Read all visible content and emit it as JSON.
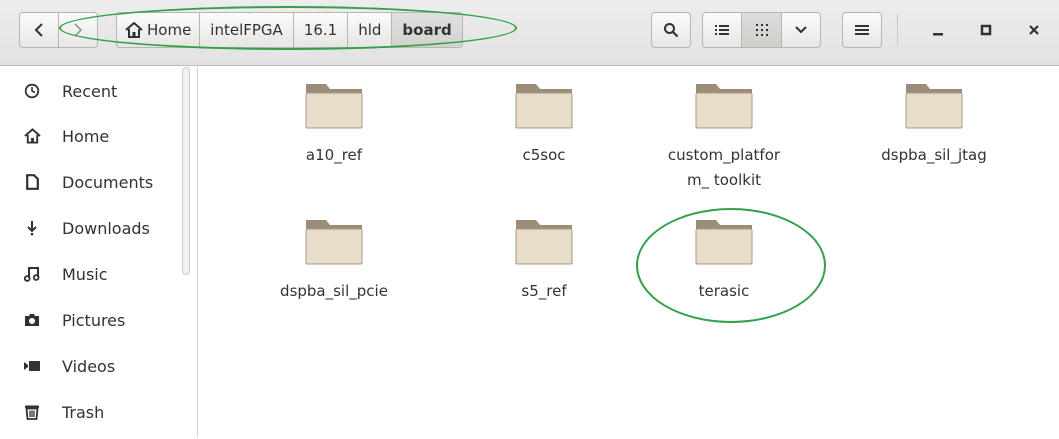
{
  "headerbar": {
    "breadcrumbs": [
      "Home",
      "intelFPGA",
      "16.1",
      "hld",
      "board"
    ],
    "active_crumb": "board",
    "icons": {
      "back": "chevron-left-icon",
      "forward": "chevron-right-icon",
      "home": "home-icon",
      "search": "search-icon",
      "list_view": "list-view-icon",
      "grid_view": "grid-view-icon",
      "view_options": "chevron-down-icon",
      "menu": "hamburger-menu-icon",
      "minimize": "minimize-icon",
      "maximize": "maximize-icon",
      "close": "close-icon"
    }
  },
  "sidebar": {
    "items": [
      {
        "label": "Recent",
        "icon": "clock-icon"
      },
      {
        "label": "Home",
        "icon": "home-icon"
      },
      {
        "label": "Documents",
        "icon": "document-icon"
      },
      {
        "label": "Downloads",
        "icon": "download-icon"
      },
      {
        "label": "Music",
        "icon": "music-icon"
      },
      {
        "label": "Pictures",
        "icon": "camera-icon"
      },
      {
        "label": "Videos",
        "icon": "video-icon"
      },
      {
        "label": "Trash",
        "icon": "trash-icon"
      }
    ]
  },
  "files": [
    {
      "name": "a10_ref",
      "icon": "folder-icon"
    },
    {
      "name": "c5soc",
      "icon": "folder-icon"
    },
    {
      "name": "custom_platform_ toolkit",
      "icon": "folder-icon"
    },
    {
      "name": "dspba_sil_jtag",
      "icon": "folder-icon"
    },
    {
      "name": "dspba_sil_pcie",
      "icon": "folder-icon"
    },
    {
      "name": "s5_ref",
      "icon": "folder-icon"
    },
    {
      "name": "terasic",
      "icon": "folder-icon"
    }
  ],
  "colors": {
    "annotation": "#35a04a",
    "folder_tab": "#9c8c78",
    "folder_body": "#e8dccb"
  }
}
